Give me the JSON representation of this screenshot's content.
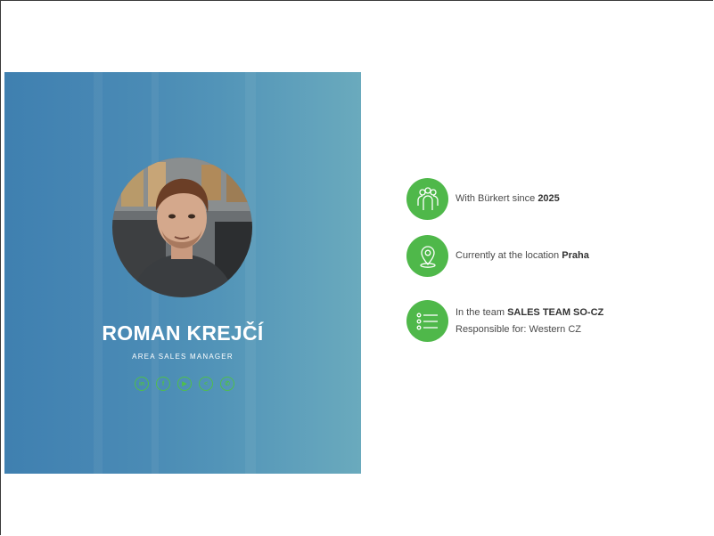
{
  "profile": {
    "name": "ROMAN KREJČÍ",
    "role": "AREA SALES MANAGER",
    "socials": [
      {
        "label": "in",
        "icon": "linkedin-icon"
      },
      {
        "label": "f",
        "icon": "facebook-icon"
      },
      {
        "label": "▶",
        "icon": "youtube-icon"
      },
      {
        "label": "<",
        "icon": "share-icon"
      },
      {
        "label": "✆",
        "icon": "whatsapp-icon"
      }
    ]
  },
  "info": {
    "since_prefix": "With Bürkert since ",
    "since_value": "2025",
    "location_prefix": "Currently at the location ",
    "location_value": "Praha",
    "team_prefix": "In the team ",
    "team_value": "SALES TEAM SO-CZ",
    "responsible": "Responsible for: Western CZ"
  },
  "colors": {
    "accent_green": "#4fb84a",
    "card_gradient_start": "#3f80b0",
    "card_gradient_end": "#6aaabd"
  }
}
